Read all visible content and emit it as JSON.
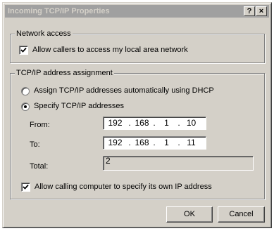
{
  "window": {
    "title": "Incoming TCP/IP Properties",
    "help_label": "?",
    "close_label": "×"
  },
  "network_access": {
    "group_label": "Network access",
    "allow_lan_label": "Allow callers to access my local area network",
    "allow_lan_checked": true
  },
  "tcpip": {
    "group_label": "TCP/IP address assignment",
    "dhcp_label": "Assign TCP/IP addresses automatically using DHCP",
    "dhcp_selected": false,
    "specify_label": "Specify TCP/IP addresses",
    "specify_selected": true,
    "from_label": "From:",
    "from_octets": [
      "192",
      "168",
      "1",
      "10"
    ],
    "to_label": "To:",
    "to_octets": [
      "192",
      "168",
      "1",
      "11"
    ],
    "total_label": "Total:",
    "total_value": "2",
    "allow_own_ip_label": "Allow calling computer to specify its own IP address",
    "allow_own_ip_checked": true
  },
  "buttons": {
    "ok": "OK",
    "cancel": "Cancel"
  }
}
